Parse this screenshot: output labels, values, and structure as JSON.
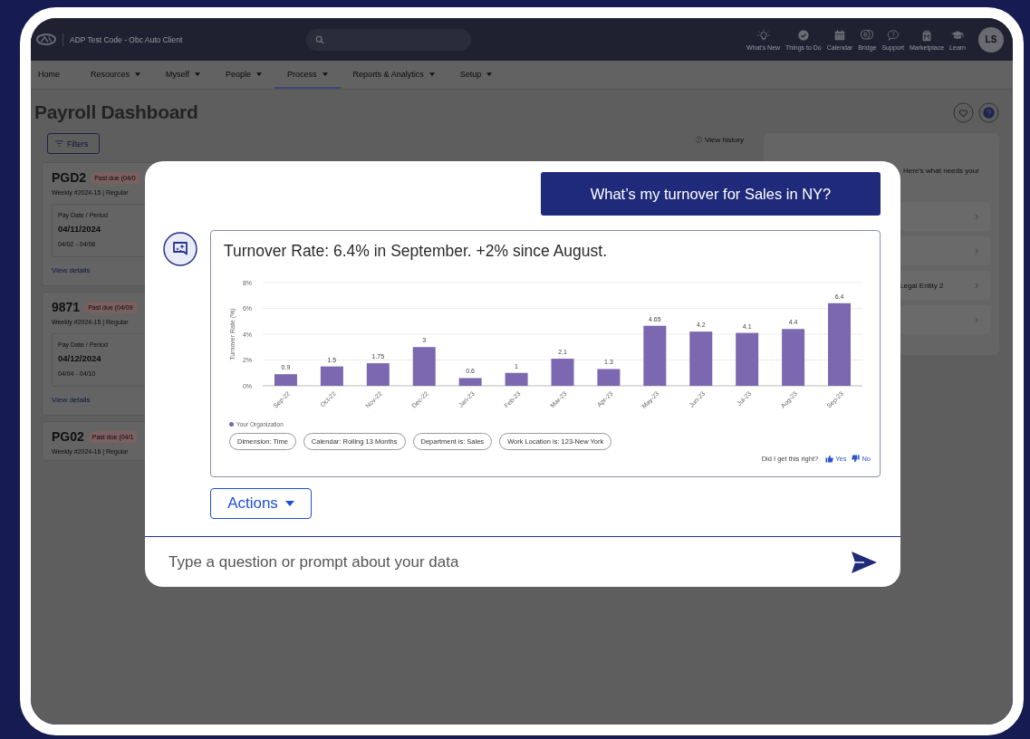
{
  "header": {
    "app_title": "ADP Test Code - Obc Auto Client",
    "tools": [
      {
        "kind": "bulb",
        "label": "What's New"
      },
      {
        "kind": "check",
        "label": "Things to Do"
      },
      {
        "kind": "calendar",
        "label": "Calendar"
      },
      {
        "kind": "bridge",
        "label": "Bridge"
      },
      {
        "kind": "support",
        "label": "Support"
      },
      {
        "kind": "marketplace",
        "label": "Marketplace"
      },
      {
        "kind": "learn",
        "label": "Learn"
      }
    ],
    "avatar": "LS"
  },
  "nav": [
    {
      "label": "Home",
      "dropdown": false,
      "selected": false
    },
    {
      "label": "Resources",
      "dropdown": true,
      "selected": false
    },
    {
      "label": "Myself",
      "dropdown": true,
      "selected": false
    },
    {
      "label": "People",
      "dropdown": true,
      "selected": false
    },
    {
      "label": "Process",
      "dropdown": true,
      "selected": true
    },
    {
      "label": "Reports & Analytics",
      "dropdown": true,
      "selected": false
    },
    {
      "label": "Setup",
      "dropdown": true,
      "selected": false
    }
  ],
  "page_title": "Payroll Dashboard",
  "filters_button": "Filters",
  "view_history": "View history",
  "payroll_cards": [
    {
      "name": "PGD2",
      "status": "Past due (04/0",
      "schedule": "Weekly #2024-15 | Regular",
      "pay_date_label": "Pay Date / Period",
      "pay_date": "04/11/2024",
      "period": "04/02 - 04/08",
      "link": "View details"
    },
    {
      "name": "9871",
      "status": "Past due (04/09",
      "schedule": "Weekly #2024-15 | Regular",
      "pay_date_label": "Pay Date / Period",
      "pay_date": "04/12/2024",
      "period": "04/04 - 04/10",
      "link": "View details"
    },
    {
      "name": "PG02",
      "status": "Past due (04/1",
      "schedule": "Weekly #2024-16 | Regular"
    }
  ],
  "assist_panel": {
    "intro": "Here's what needs your",
    "items": [
      {
        "kind": "row"
      },
      {
        "kind": "row"
      },
      {
        "kind": "row",
        "text": "Legal Entity 2"
      },
      {
        "kind": "row"
      }
    ]
  },
  "chat": {
    "question": "What’s my turnover for Sales in NY?",
    "answer": {
      "title": "Turnover Rate: 6.4% in September. +2% since August.",
      "chart_data": {
        "type": "bar",
        "ylabel": "Turnover Rate (%)",
        "categories": [
          "Sep-22",
          "Oct-22",
          "Nov-22",
          "Dec-22",
          "Jan-23",
          "Feb-23",
          "Mar-23",
          "Apr-23",
          "May-23",
          "Jun-23",
          "Jul-23",
          "Aug-23",
          "Sep-23"
        ],
        "series": [
          {
            "name": "Your Organization",
            "color": "#7b68b0",
            "values": [
              0.9,
              1.5,
              1.75,
              3,
              0.6,
              1,
              2.1,
              1.3,
              4.65,
              4.2,
              4.1,
              4.4,
              6.4
            ]
          }
        ],
        "ylim": [
          0,
          8
        ],
        "yticks": [
          {
            "value": 0,
            "label": "0%"
          },
          {
            "value": 2,
            "label": "2%"
          },
          {
            "value": 4,
            "label": "4%"
          },
          {
            "value": 6,
            "label": "6%"
          },
          {
            "value": 8,
            "label": "8%"
          }
        ],
        "data_labels": true,
        "grid": true
      },
      "filters": [
        "Dimension: Time",
        "Calendar: Rolling 13 Months",
        "Department is: Sales",
        "Work Location is: 123-New York"
      ],
      "feedback": {
        "prompt": "Did I get this right?",
        "yes": "Yes",
        "no": "No"
      }
    },
    "actions_button": "Actions",
    "input": {
      "placeholder": "Type a question or prompt about your data"
    }
  }
}
